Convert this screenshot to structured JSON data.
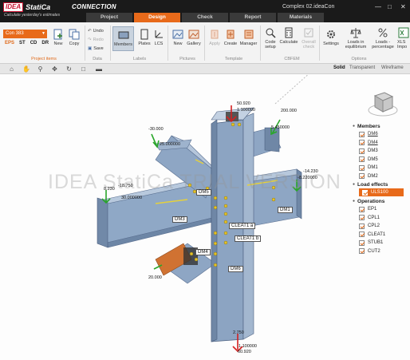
{
  "app": {
    "logo_idea": "IDEA",
    "logo_statica": "StatiCa",
    "logo_product": "CONNECTION",
    "tagline": "Calculate yesterday's estimates",
    "document_title": "Complex 02.ideaCon"
  },
  "menu_tabs": [
    "Project",
    "Design",
    "Check",
    "Report",
    "Materials"
  ],
  "ribbon": {
    "project": {
      "con_name": "Con 383",
      "nav": [
        "EPS",
        "ST",
        "CD",
        "DR"
      ],
      "new_label": "New",
      "copy_label": "Copy",
      "group_label": "Project items"
    },
    "data": {
      "undo": "Undo",
      "redo": "Redo",
      "save": "Save",
      "group_label": "Data"
    },
    "labels": {
      "members": "Members",
      "plates": "Plates",
      "lcs": "LCS",
      "group_label": "Labels"
    },
    "pictures": {
      "new": "New",
      "gallery": "Gallery",
      "group_label": "Pictures"
    },
    "template": {
      "apply": "Apply",
      "create": "Create",
      "manager": "Manager",
      "group_label": "Template"
    },
    "cbfem": {
      "code_setup_1": "Code",
      "code_setup_2": "setup",
      "calculate": "Calculate",
      "overall_1": "Overall",
      "overall_2": "check",
      "group_label": "CBFEM"
    },
    "options": {
      "settings": "Settings",
      "loads_eq_1": "Loads in",
      "loads_eq_2": "equilibrium",
      "loads_pct_1": "Loads -",
      "loads_pct_2": "percentage",
      "xls_1": "XLS",
      "xls_2": "Impo",
      "group_label": "Options"
    }
  },
  "view_modes": [
    "Solid",
    "Transparent",
    "Wireframe"
  ],
  "watermark": "IDEA StatiCa TRIAL VERSION",
  "panel": {
    "members_title": "Members",
    "members": [
      "DM6",
      "DM4",
      "DM3",
      "DM5",
      "DM1",
      "DM2"
    ],
    "loads_title": "Load effects",
    "load_active": "ULS100",
    "operations_title": "Operations",
    "operations": [
      "EP1",
      "CPL1",
      "CPL2",
      "CLEAT1",
      "STUB1",
      "CUT2"
    ]
  },
  "model_labels": {
    "members": [
      "DM5",
      "DM3",
      "DM1",
      "DM4",
      "DM6"
    ],
    "cleats": [
      "CLEAT1 a",
      "CLEAT1 b"
    ],
    "loads": [
      "50.920",
      "1.100000",
      "200.000",
      "5.450000",
      "-30.000",
      "25.000000",
      "8.230",
      "-18.750",
      "30.000000",
      "-14.230",
      "-8.220000",
      "20.000",
      "2.750",
      "1.100000",
      "60.920"
    ]
  },
  "colors": {
    "accent": "#e86a1a",
    "steel": "#7f98b8",
    "titlebar": "#1a1a1a"
  }
}
